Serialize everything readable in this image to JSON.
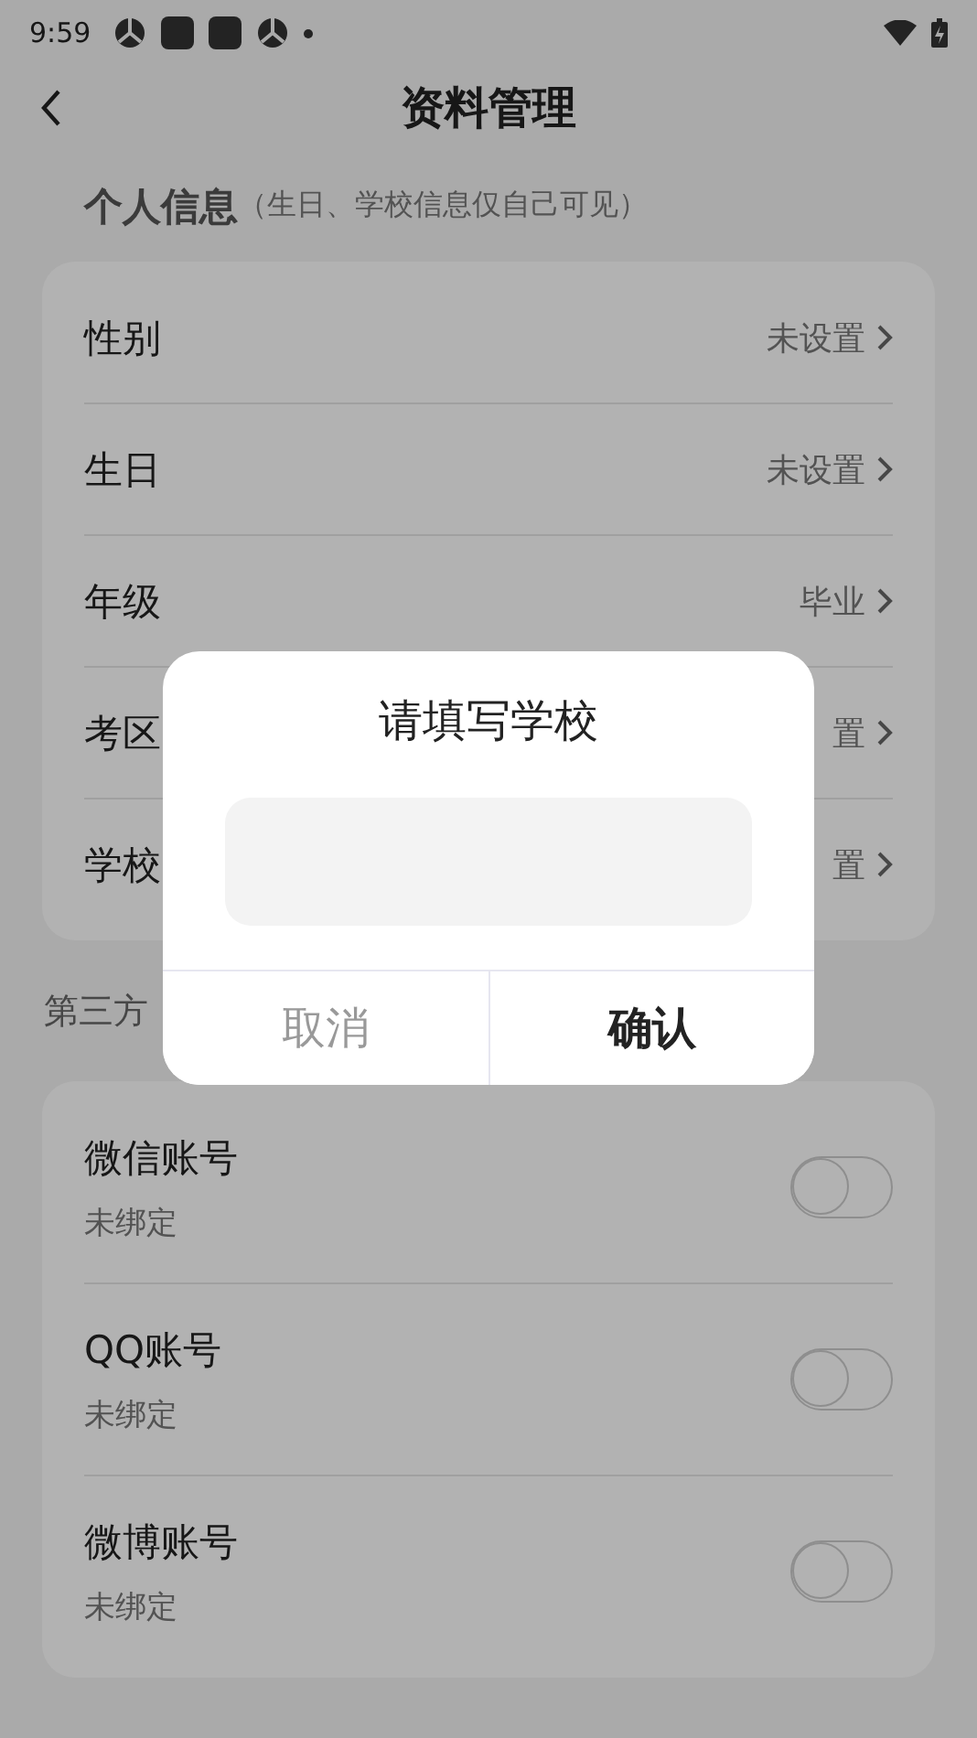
{
  "status_bar": {
    "time": "9:59"
  },
  "header": {
    "title": "资料管理"
  },
  "personal": {
    "title": "个人信息",
    "note": "（生日、学校信息仅自己可见）",
    "rows": [
      {
        "label": "性别",
        "value": "未设置"
      },
      {
        "label": "生日",
        "value": "未设置"
      },
      {
        "label": "年级",
        "value": "毕业"
      },
      {
        "label": "考区",
        "value": "置"
      },
      {
        "label": "学校",
        "value": "置"
      }
    ]
  },
  "third_party": {
    "title": "第三方",
    "rows": [
      {
        "label": "微信账号",
        "status": "未绑定",
        "on": false
      },
      {
        "label": "QQ账号",
        "status": "未绑定",
        "on": false
      },
      {
        "label": "微博账号",
        "status": "未绑定",
        "on": false
      }
    ]
  },
  "dialog": {
    "title": "请填写学校",
    "buttons": [
      {
        "label": "取消",
        "kind": "cancel"
      },
      {
        "label": "确认",
        "kind": "confirm"
      }
    ]
  }
}
